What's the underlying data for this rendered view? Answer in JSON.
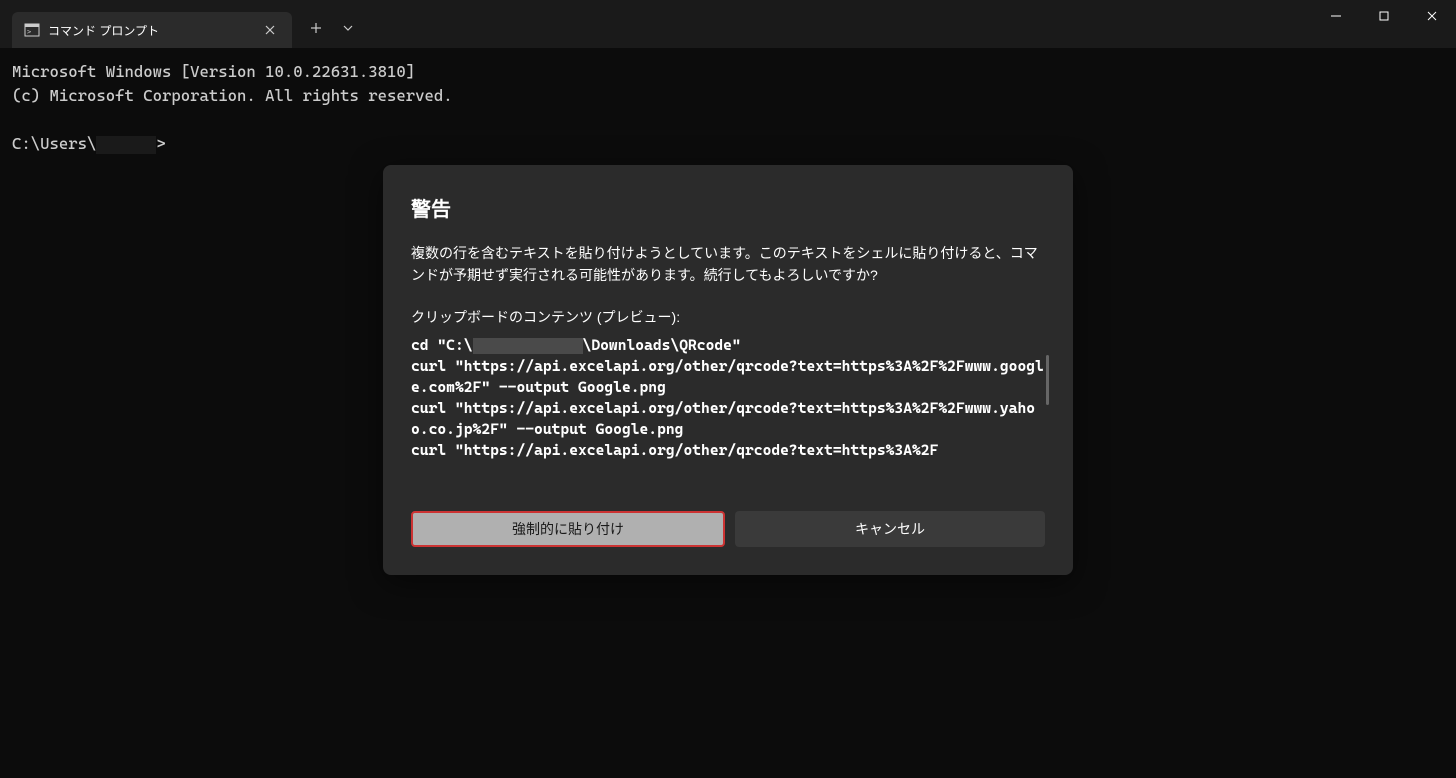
{
  "titlebar": {
    "tab_title": "コマンド プロンプト"
  },
  "terminal": {
    "line1": "Microsoft Windows [Version 10.0.22631.3810]",
    "line2": "(c) Microsoft Corporation. All rights reserved.",
    "prompt_prefix": "C:\\Users\\",
    "prompt_suffix": ">"
  },
  "dialog": {
    "title": "警告",
    "message": "複数の行を含むテキストを貼り付けようとしています。このテキストをシェルに貼り付けると、コマンドが予期せず実行される可能性があります。続行してもよろしいですか?",
    "preview_label": "クリップボードのコンテンツ (プレビュー):",
    "preview_line1_prefix": "cd \"C:\\",
    "preview_line1_suffix": "\\Downloads\\QRcode\"",
    "preview_line2": "curl \"https://api.excelapi.org/other/qrcode?text=https%3A%2F%2Fwww.google.com%2F\" --output Google.png",
    "preview_line3": "curl \"https://api.excelapi.org/other/qrcode?text=https%3A%2F%2Fwww.yahoo.co.jp%2F\" --output Google.png",
    "preview_line4": "curl \"https://api.excelapi.org/other/qrcode?text=https%3A%2F",
    "button_paste": "強制的に貼り付け",
    "button_cancel": "キャンセル"
  }
}
